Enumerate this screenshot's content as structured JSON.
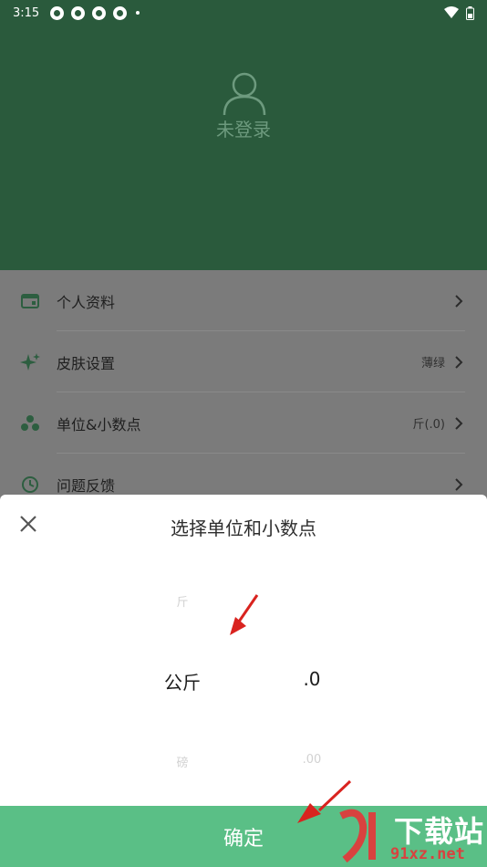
{
  "status_bar": {
    "time": "3:15"
  },
  "header": {
    "login_label": "未登录"
  },
  "settings": {
    "items": [
      {
        "label": "个人资料",
        "value": ""
      },
      {
        "label": "皮肤设置",
        "value": "薄绿"
      },
      {
        "label": "单位&小数点",
        "value": "斤(.0)"
      },
      {
        "label": "问题反馈",
        "value": ""
      }
    ]
  },
  "sheet": {
    "title": "选择单位和小数点",
    "unit_options": [
      "斤",
      "公斤",
      "磅"
    ],
    "decimal_options": [
      "",
      ".0",
      ".00"
    ],
    "confirm_label": "确定"
  },
  "watermark": {
    "big": "下载站",
    "small": "91xz.net"
  },
  "colors": {
    "header_bg": "#2a5a3c",
    "accent": "#5abf86",
    "overlay": "#7b7b7b",
    "arrow": "#d9231f"
  }
}
